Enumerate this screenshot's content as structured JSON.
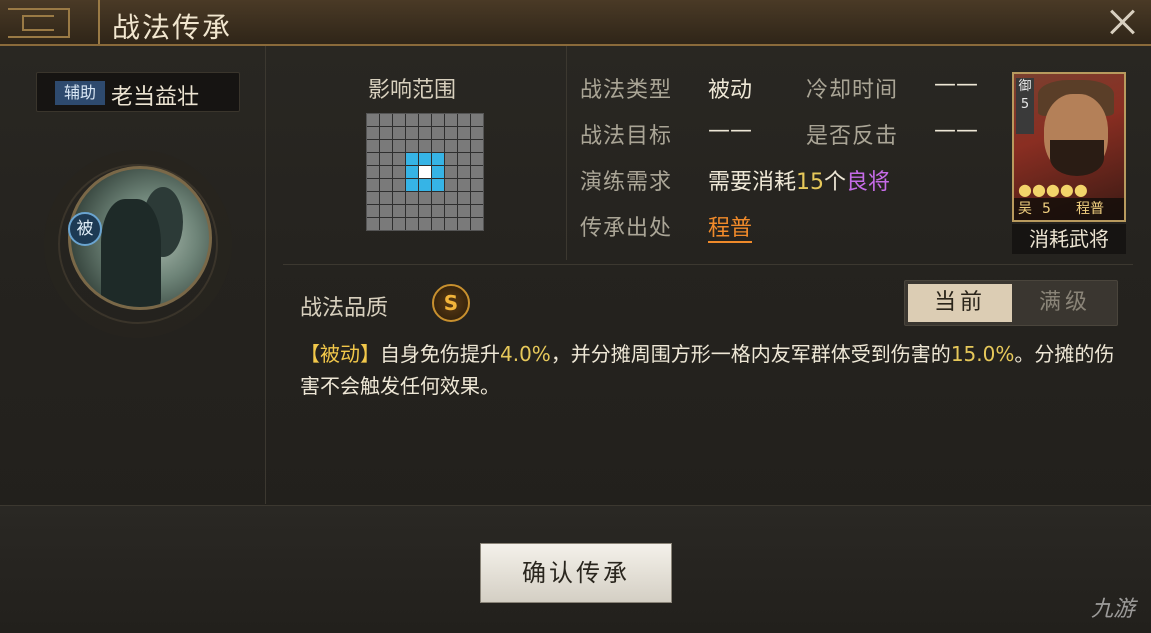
{
  "window": {
    "title": "战法传承"
  },
  "left": {
    "role_badge": "辅助",
    "skill_name": "老当益壮",
    "passive_mark": "被"
  },
  "range": {
    "title": "影响范围",
    "grid": {
      "size": 9,
      "center": [
        4,
        4
      ],
      "radius": 1
    }
  },
  "info": {
    "type_label": "战法类型",
    "type_value": "被动",
    "cooldown_label": "冷却时间",
    "cooldown_value": "——",
    "target_label": "战法目标",
    "target_value": "——",
    "counter_label": "是否反击",
    "counter_value": "——",
    "drill_label": "演练需求",
    "drill_prefix": "需要消耗",
    "drill_count": "15",
    "drill_unit": "个",
    "drill_item": "良将",
    "source_label": "传承出处",
    "source_value": "程普"
  },
  "card": {
    "side_label": "御",
    "side_num": "5",
    "stars": "●●●●●",
    "faction": "吴",
    "cost": "5",
    "name": "程普",
    "caption": "消耗武将"
  },
  "quality": {
    "label": "战法品质",
    "grade": "S",
    "toggle_current": "当前",
    "toggle_max": "满级"
  },
  "description": {
    "tag": "【被动】",
    "part1": "自身免伤提升",
    "value1": "4.0%",
    "part2": "，并分摊周围方形一格内友军群体受到伤害的",
    "value2": "15.0%",
    "part3": "。分摊的伤害不会触发任何效果。"
  },
  "footer": {
    "confirm_label": "确认传承",
    "watermark": "九游"
  }
}
